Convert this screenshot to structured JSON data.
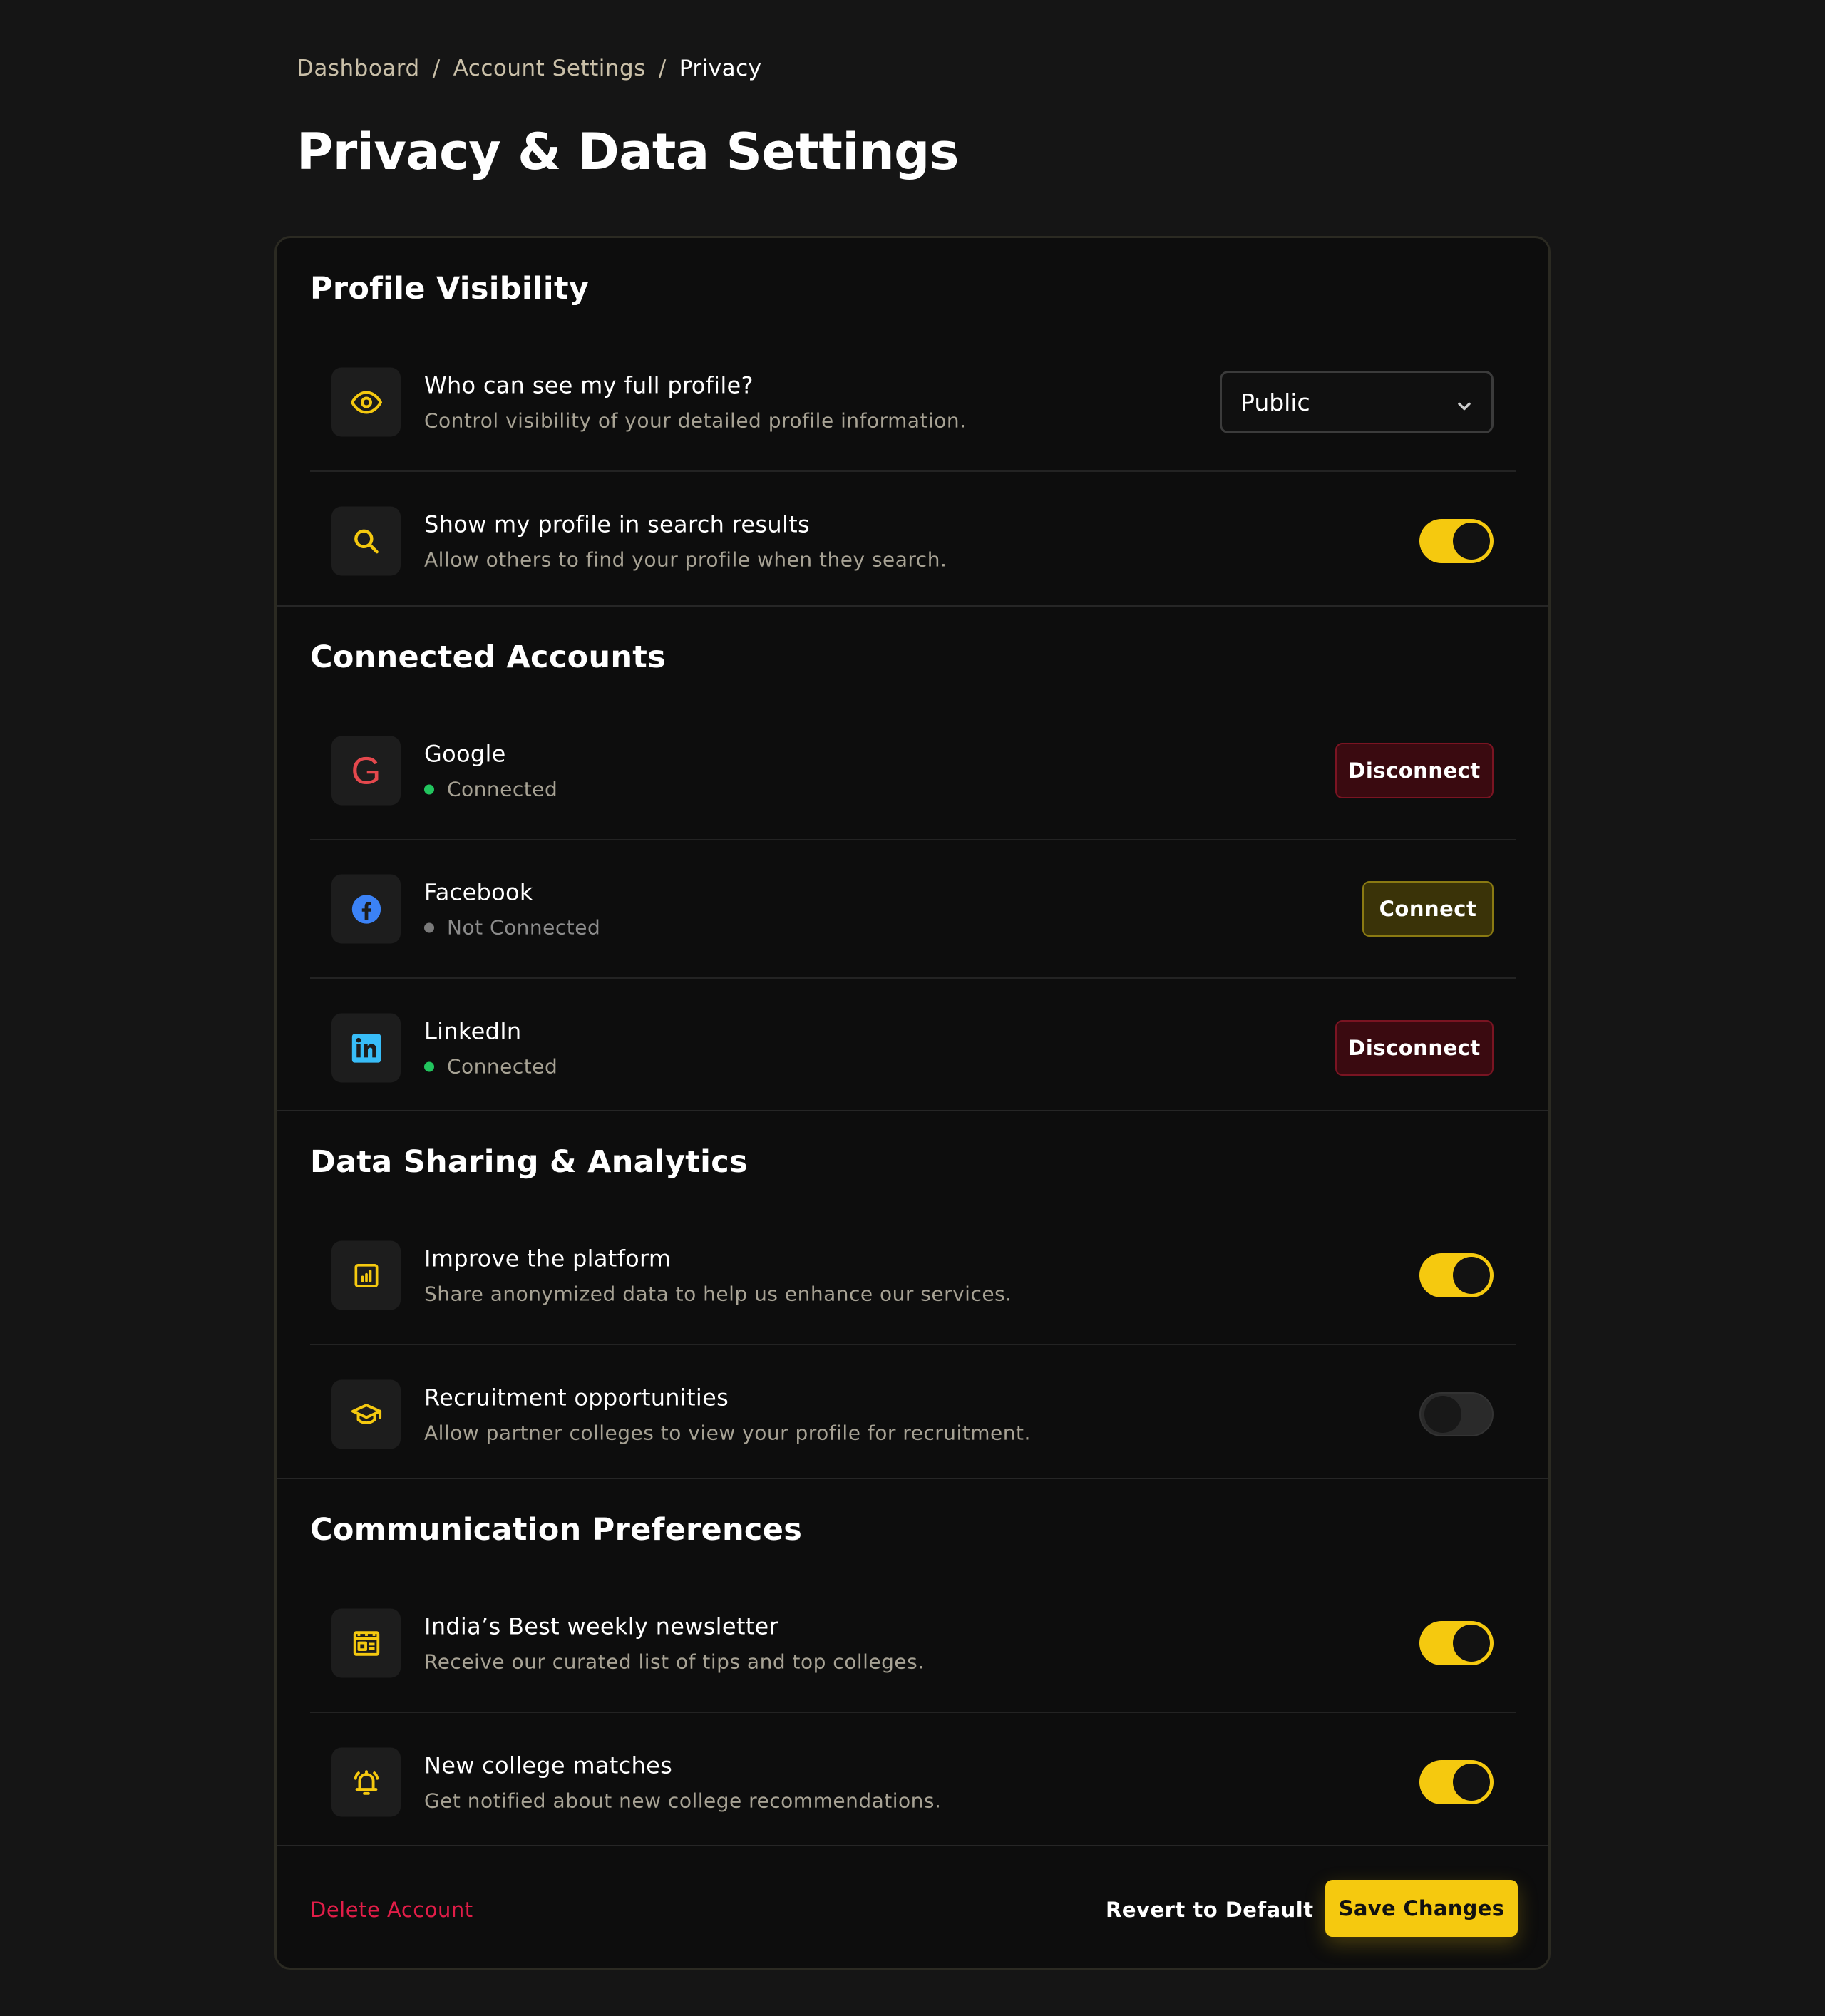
{
  "breadcrumb": {
    "items": [
      "Dashboard",
      "Account Settings",
      "Privacy"
    ],
    "separator": "/"
  },
  "page_title": "Privacy & Data Settings",
  "colors": {
    "accent": "#f5c90f",
    "danger": "#e11d48",
    "success": "#22c55e",
    "background": "#151515",
    "card": "#0d0d0d"
  },
  "sections": {
    "profile_visibility": {
      "title": "Profile Visibility",
      "full_profile": {
        "icon": "eye-icon",
        "title": "Who can see my full profile?",
        "description": "Control visibility of your detailed profile information.",
        "select_value": "Public"
      },
      "search_results": {
        "icon": "search-icon",
        "title": "Show my profile in search results",
        "description": "Allow others to find your profile when they search.",
        "enabled": true
      }
    },
    "connected_accounts": {
      "title": "Connected Accounts",
      "google": {
        "icon": "google-icon",
        "name": "Google",
        "status": "Connected",
        "action": "Disconnect"
      },
      "facebook": {
        "icon": "facebook-icon",
        "name": "Facebook",
        "status": "Not Connected",
        "action": "Connect"
      },
      "linkedin": {
        "icon": "linkedin-icon",
        "name": "LinkedIn",
        "status": "Connected",
        "action": "Disconnect"
      }
    },
    "data_sharing": {
      "title": "Data Sharing & Analytics",
      "improve": {
        "icon": "analytics-icon",
        "title": "Improve the platform",
        "description": "Share anonymized data to help us enhance our services.",
        "enabled": true
      },
      "recruitment": {
        "icon": "graduation-cap-icon",
        "title": "Recruitment opportunities",
        "description": "Allow partner colleges to view your profile for recruitment.",
        "enabled": false
      }
    },
    "communication": {
      "title": "Communication Preferences",
      "newsletter": {
        "icon": "newsletter-icon",
        "title": "India’s Best weekly newsletter",
        "description": "Receive our curated list of tips and top colleges.",
        "enabled": true
      },
      "matches": {
        "icon": "bell-icon",
        "title": "New college matches",
        "description": "Get notified about new college recommendations.",
        "enabled": true
      }
    }
  },
  "footer": {
    "delete_label": "Delete Account",
    "revert_label": "Revert to Default",
    "save_label": "Save Changes"
  }
}
